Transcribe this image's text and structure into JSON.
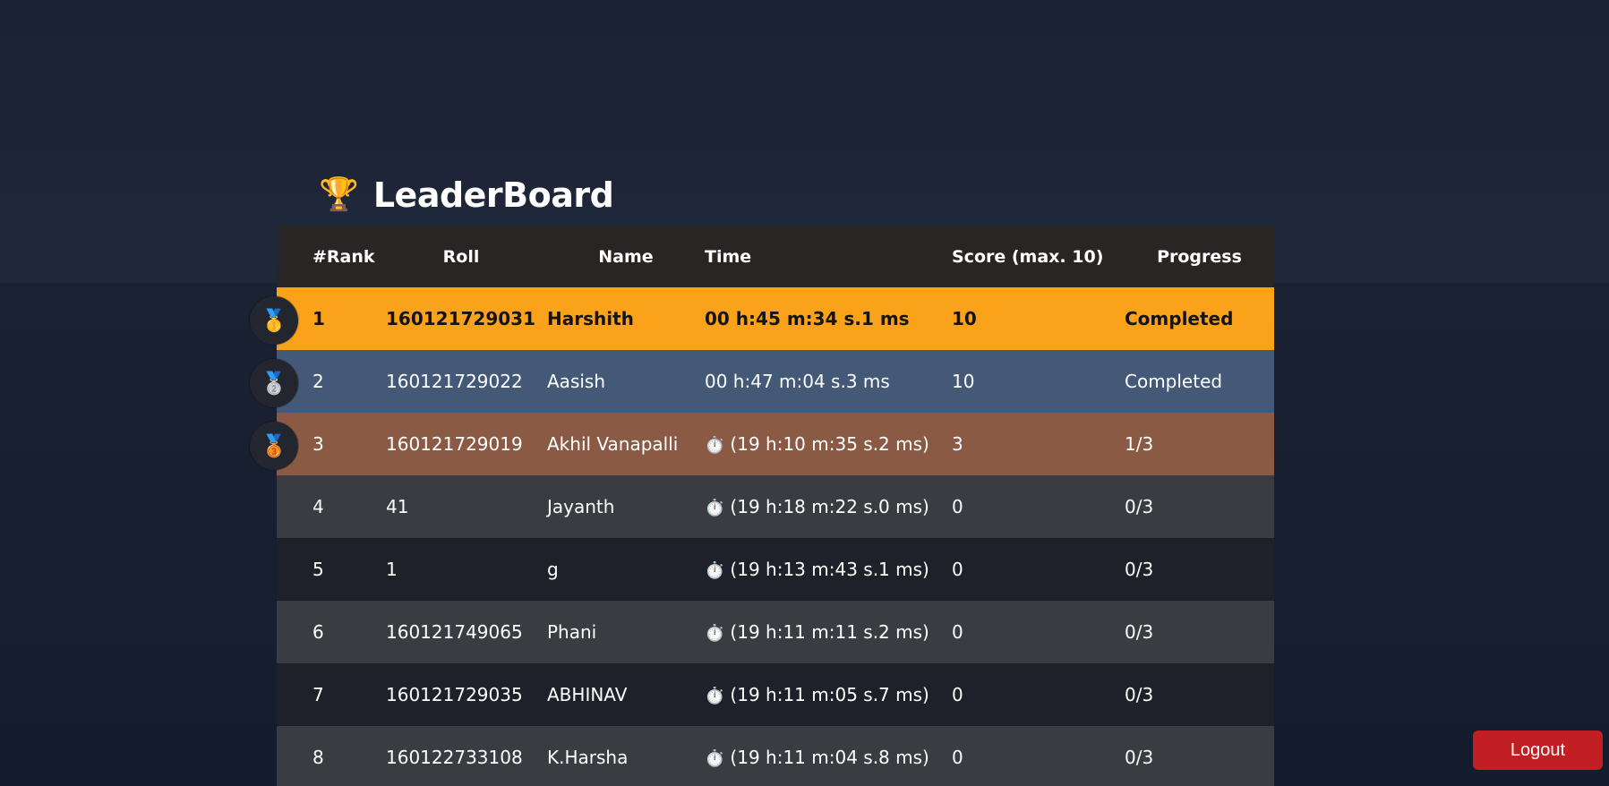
{
  "page": {
    "title": "LeaderBoard",
    "trophy_icon": "🏆"
  },
  "table": {
    "headers": [
      "#Rank",
      "Roll",
      "Name",
      "Time",
      "Score (max. 10)",
      "Progress"
    ],
    "rows": [
      {
        "rank": "1",
        "roll": "160121729031",
        "name": "Harshith",
        "time": "00 h:45 m:34 s.1 ms",
        "score": "10",
        "progress": "Completed",
        "medal": "🥇",
        "timer": false
      },
      {
        "rank": "2",
        "roll": "160121729022",
        "name": "Aasish",
        "time": "00 h:47 m:04 s.3 ms",
        "score": "10",
        "progress": "Completed",
        "medal": "🥈",
        "timer": false
      },
      {
        "rank": "3",
        "roll": "160121729019",
        "name": "Akhil Vanapalli",
        "time": "(19 h:10 m:35 s.2 ms)",
        "score": "3",
        "progress": "1/3",
        "medal": "🥉",
        "timer": true
      },
      {
        "rank": "4",
        "roll": "41",
        "name": "Jayanth",
        "time": "(19 h:18 m:22 s.0 ms)",
        "score": "0",
        "progress": "0/3",
        "timer": true
      },
      {
        "rank": "5",
        "roll": "1",
        "name": "g",
        "time": "(19 h:13 m:43 s.1 ms)",
        "score": "0",
        "progress": "0/3",
        "timer": true
      },
      {
        "rank": "6",
        "roll": "160121749065",
        "name": "Phani",
        "time": "(19 h:11 m:11 s.2 ms)",
        "score": "0",
        "progress": "0/3",
        "timer": true
      },
      {
        "rank": "7",
        "roll": "160121729035",
        "name": "ABHINAV",
        "time": "(19 h:11 m:05 s.7 ms)",
        "score": "0",
        "progress": "0/3",
        "timer": true
      },
      {
        "rank": "8",
        "roll": "160122733108",
        "name": "K.Harsha",
        "time": "(19 h:11 m:04 s.8 ms)",
        "score": "0",
        "progress": "0/3",
        "timer": true
      }
    ]
  },
  "buttons": {
    "logout_label": "Logout"
  },
  "colors": {
    "first": "#f9a21a",
    "second": "#435977",
    "third": "#8b5a44",
    "logout": "#c21f24"
  }
}
